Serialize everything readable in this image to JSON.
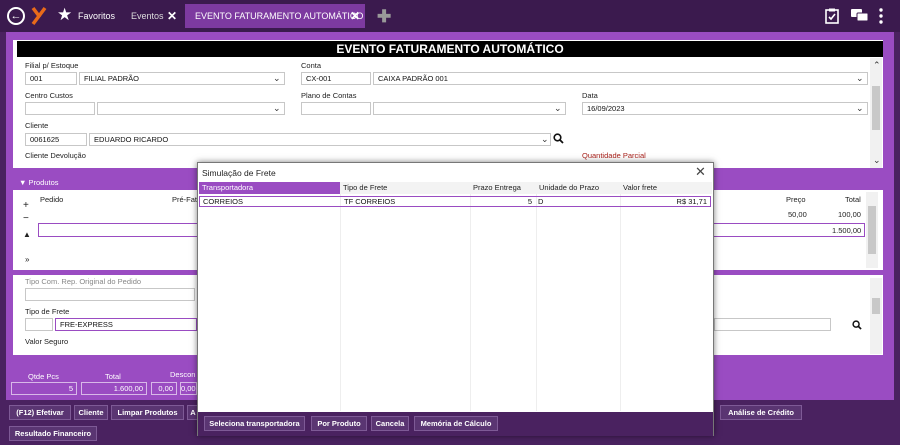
{
  "topbar": {
    "favorites_label": "Favoritos",
    "tab_events": "Eventos",
    "tab_active": "EVENTO FATURAMENTO AUTOMÁTICO",
    "close_glyph": "✕",
    "plus_glyph": "✚"
  },
  "form": {
    "title": "EVENTO FATURAMENTO AUTOMÁTICO",
    "filial_label": "Filial p/ Estoque",
    "filial_code": "001",
    "filial_name": "FILIAL PADRÃO",
    "conta_label": "Conta",
    "conta_code": "CX-001",
    "conta_name": "CAIXA PADRÃO 001",
    "centro_label": "Centro Custos",
    "plano_label": "Plano de Contas",
    "data_label": "Data",
    "data_value": "16/09/2023",
    "cliente_label": "Cliente",
    "cliente_code": "0061625",
    "cliente_name": "EDUARDO RICARDO",
    "cliente_devolucao_label": "Cliente Devolução",
    "quantidade_parcial_label": "Quantidade Parcial"
  },
  "produtos": {
    "section_label": "▼ Produtos",
    "col_pedido": "Pedido",
    "col_prefat": "Pré-Fat",
    "col_preco": "Preço",
    "col_total": "Total",
    "row1_preco": "50,00",
    "row1_total": "100,00",
    "row2_total": "1.500,00"
  },
  "lower": {
    "tipo_com_label": "Tipo Com. Rep. Original do Pedido",
    "tipo_frete_label": "Tipo de Frete",
    "tipo_frete_value": "FRE-EXPRESS",
    "valor_seguro_label": "Valor Seguro"
  },
  "totals": {
    "qtde_label": "Qtde Pcs",
    "qtde_value": "5",
    "total_label": "Total",
    "total_value": "1.600,00",
    "desconto_label": "Descon",
    "desc1": "0,00",
    "desc2": "0,00"
  },
  "buttons": {
    "efetivar": "(F12) Efetivar",
    "cliente": "Cliente",
    "limpar": "Limpar Produtos",
    "a": "A",
    "analise": "Análise de Crédito",
    "resultado": "Resultado Financeiro"
  },
  "modal": {
    "title": "Simulação de Frete",
    "columns": [
      "Transportadora",
      "Tipo de Frete",
      "Prazo Entrega",
      "Unidade do Prazo",
      "Valor frete"
    ],
    "row": {
      "transportadora": "CORREIOS",
      "tipo_frete": "TF CORREIOS",
      "prazo": "5",
      "unidade": "D",
      "valor": "R$ 31,71"
    },
    "btn_seleciona": "Seleciona transportadora",
    "btn_por_produto": "Por Produto",
    "btn_cancela": "Cancela",
    "btn_memoria": "Memória de Cálculo"
  },
  "colors": {
    "accent": "#9a4cc2",
    "dark": "#4a2260",
    "header_bg": "#000000",
    "red_label": "#a8201a"
  }
}
